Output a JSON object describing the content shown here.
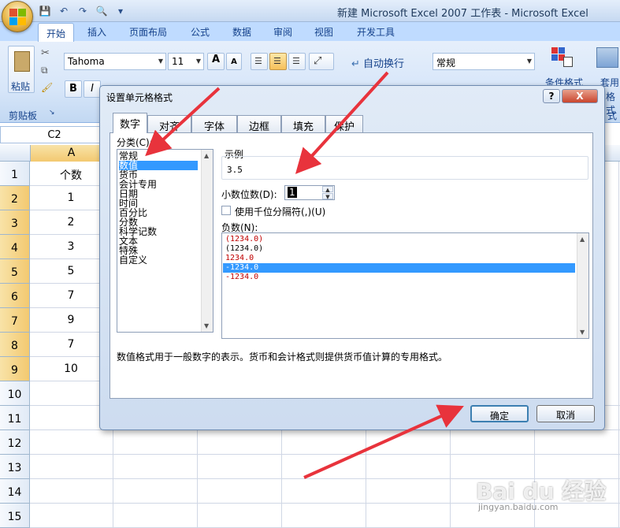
{
  "window": {
    "title": "新建 Microsoft Excel 2007 工作表 - Microsoft Excel"
  },
  "ribbon": {
    "tabs": [
      "开始",
      "插入",
      "页面布局",
      "公式",
      "数据",
      "审阅",
      "视图",
      "开发工具"
    ],
    "clipboard_paste": "粘贴",
    "clipboard_group": "剪贴板",
    "font_name": "Tahoma",
    "font_size": "11",
    "grow_font": "A",
    "shrink_font": "A",
    "bold": "B",
    "italic": "I",
    "wrap_text": "自动换行",
    "number_format": "常规",
    "conditional_format": "条件格式",
    "table_style": "套用",
    "table_style_2": "格式",
    "style_group": "式"
  },
  "sheet": {
    "name_box": "C2",
    "column_a": "A",
    "rows": [
      "1",
      "2",
      "3",
      "4",
      "5",
      "6",
      "7",
      "8",
      "9",
      "10",
      "11",
      "12",
      "13",
      "14",
      "15"
    ],
    "column_a_values": [
      "个数",
      "1",
      "2",
      "3",
      "5",
      "7",
      "9",
      "7",
      "10"
    ]
  },
  "dialog": {
    "title": "设置单元格格式",
    "help": "?",
    "close": "X",
    "tabs": [
      "数字",
      "对齐",
      "字体",
      "边框",
      "填充",
      "保护"
    ],
    "category_label": "分类(C):",
    "categories": [
      "常规",
      "数值",
      "货币",
      "会计专用",
      "日期",
      "时间",
      "百分比",
      "分数",
      "科学记数",
      "文本",
      "特殊",
      "自定义"
    ],
    "selected_category": "数值",
    "sample_label": "示例",
    "sample_value": "3.5",
    "decimal_label": "小数位数(D):",
    "decimal_value": "1",
    "thousands_label": "使用千位分隔符(,)(U)",
    "thousands_checked": false,
    "negative_label": "负数(N):",
    "negative_options": [
      "(1234.0)",
      "(1234.0)",
      "1234.0",
      "-1234.0",
      "-1234.0"
    ],
    "negative_colors": [
      "#c00000",
      "#000000",
      "#c00000",
      "#ffffff",
      "#c00000"
    ],
    "selected_negative": "-1234.0",
    "description": "数值格式用于一般数字的表示。货币和会计格式则提供货币值计算的专用格式。",
    "ok": "确定",
    "cancel": "取消"
  },
  "watermark": {
    "logo": "Bai du 经验",
    "url": "jingyan.baidu.com"
  },
  "colors": {
    "annotation_arrow": "#e8333c",
    "selection": "#3399ff",
    "ribbon_text": "#15428b"
  }
}
